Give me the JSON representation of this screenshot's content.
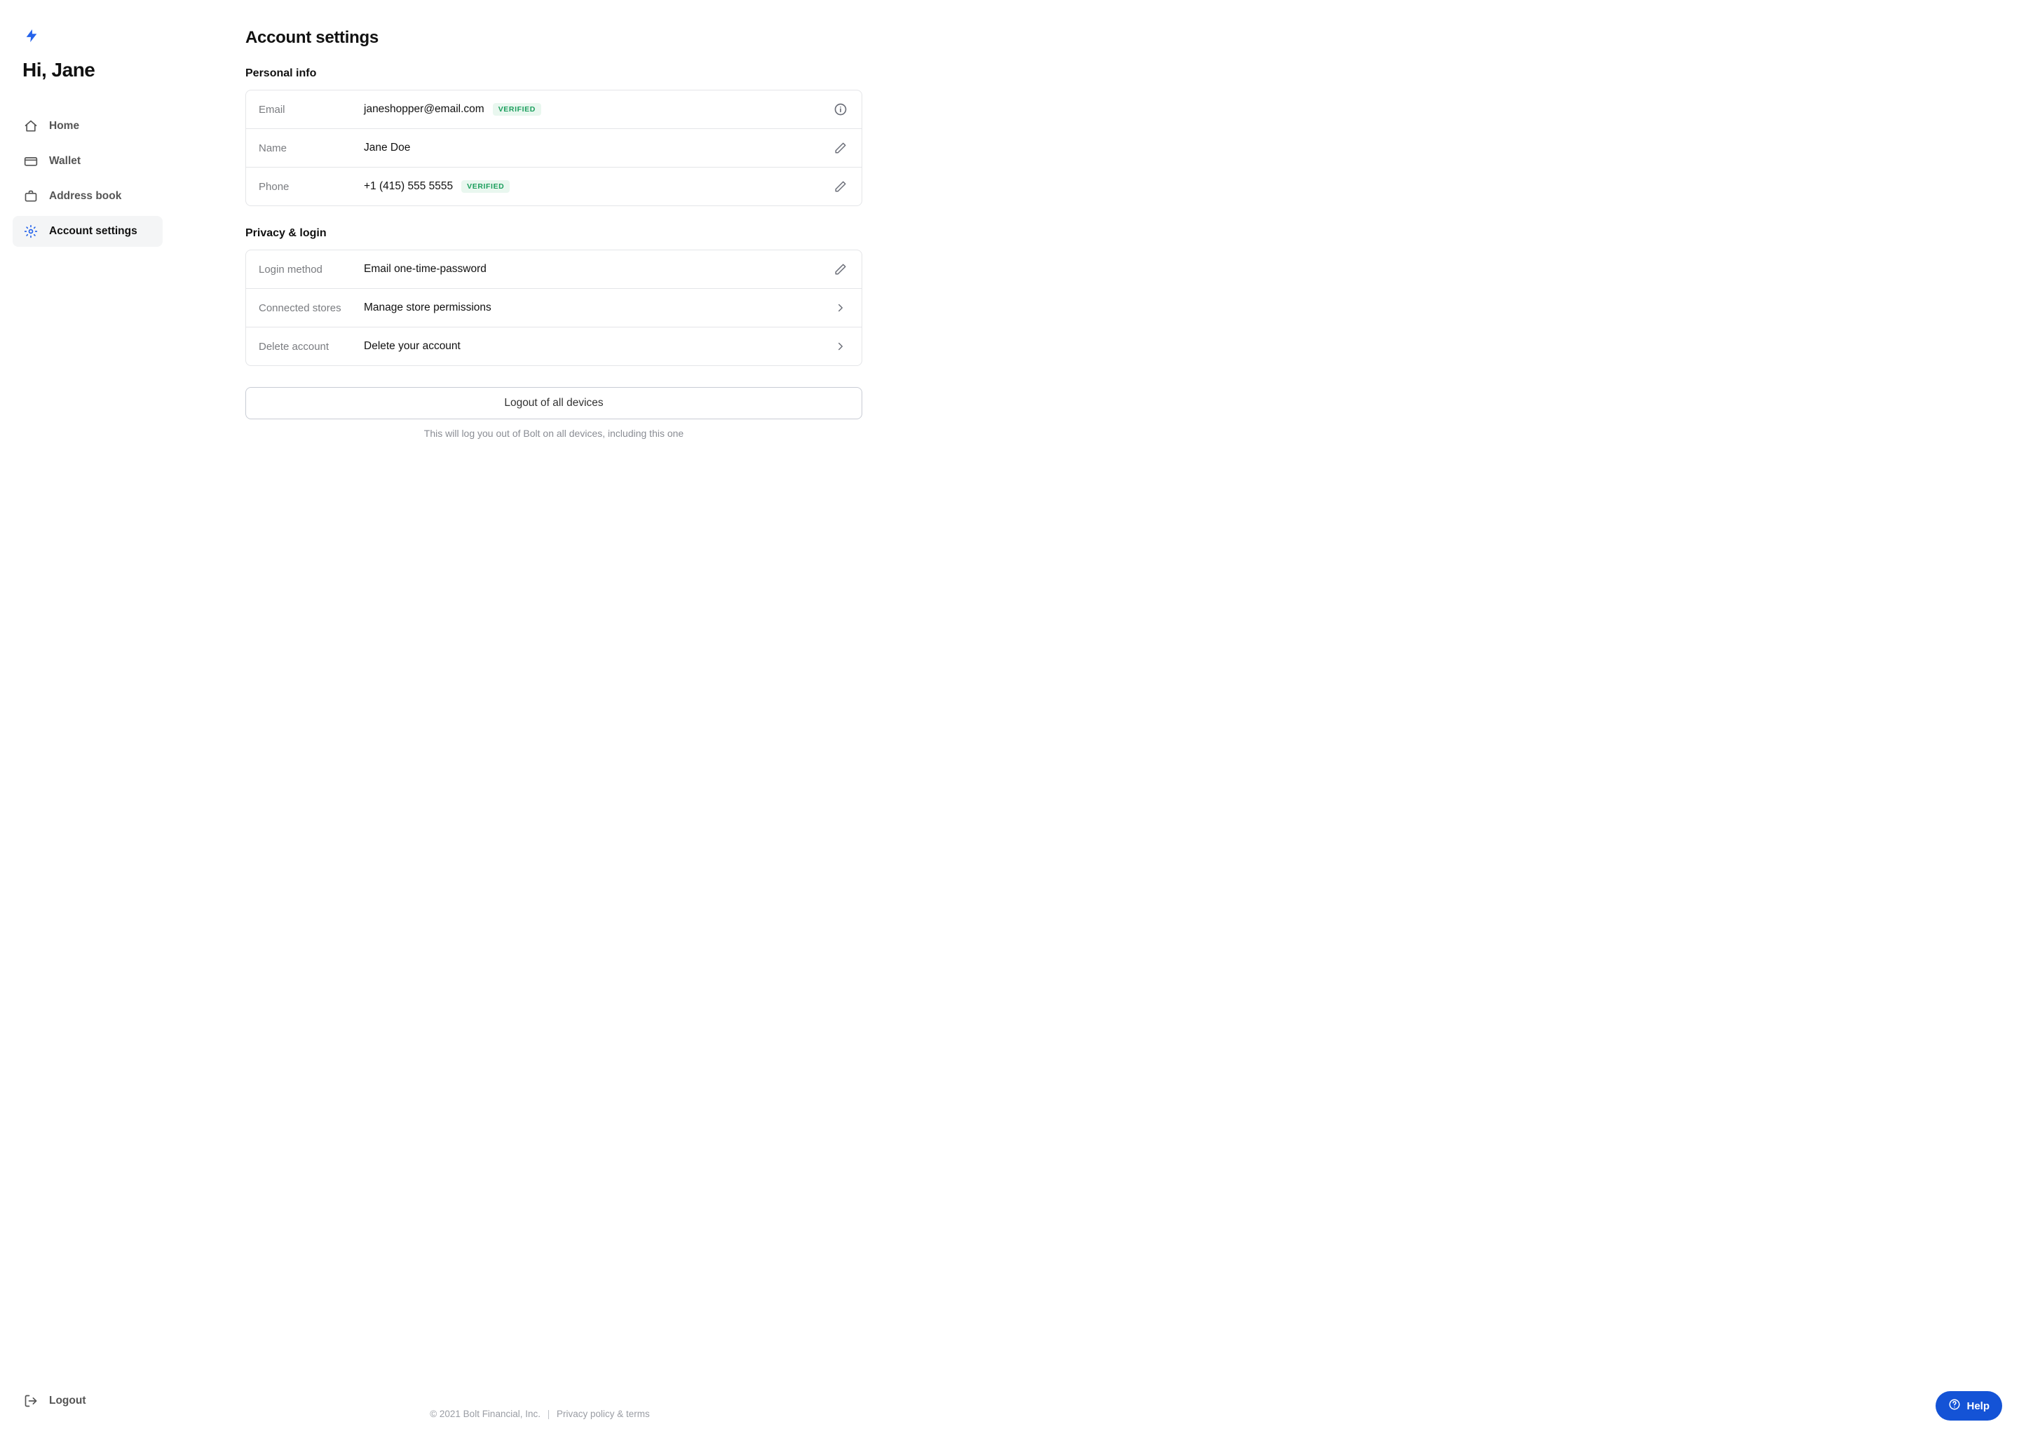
{
  "sidebar": {
    "greeting": "Hi, Jane",
    "items": [
      {
        "label": "Home"
      },
      {
        "label": "Wallet"
      },
      {
        "label": "Address book"
      },
      {
        "label": "Account settings"
      }
    ],
    "logout": "Logout"
  },
  "page": {
    "title": "Account settings",
    "sections": {
      "personal": {
        "title": "Personal info",
        "email_label": "Email",
        "email_value": "janeshopper@email.com",
        "email_badge": "VERIFIED",
        "name_label": "Name",
        "name_value": "Jane Doe",
        "phone_label": "Phone",
        "phone_value": "+1 (415) 555 5555",
        "phone_badge": "VERIFIED"
      },
      "privacy": {
        "title": "Privacy & login",
        "login_method_label": "Login method",
        "login_method_value": "Email one-time-password",
        "connected_label": "Connected stores",
        "connected_value": "Manage store permissions",
        "delete_label": "Delete account",
        "delete_value": "Delete your account"
      }
    },
    "logout_all": "Logout of all devices",
    "logout_hint": "This will log you out of Bolt on all devices, including this one"
  },
  "footer": {
    "copyright": "© 2021 Bolt Financial, Inc.",
    "privacy": "Privacy policy & terms"
  },
  "help": "Help"
}
